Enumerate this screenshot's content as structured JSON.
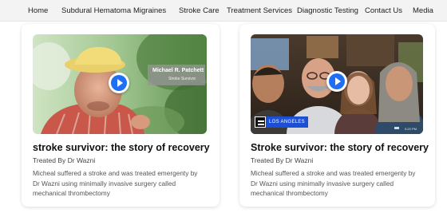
{
  "nav": {
    "items": [
      {
        "label": "Home"
      },
      {
        "label": "Subdural Hematoma"
      },
      {
        "label": "Migraines"
      },
      {
        "label": "Stroke Care"
      },
      {
        "label": "Treatment Services"
      },
      {
        "label": "Diagnostic Testing"
      },
      {
        "label": "Contact Us"
      },
      {
        "label": "Media"
      }
    ]
  },
  "cards": [
    {
      "title": "stroke survivor: the story of recovery",
      "subtitle": "Treated By Dr Wazni",
      "description": "Micheal suffered a stroke and was treated emergenty by Dr Wazni using minimally invasive surgery called mechanical thrombectomy",
      "video": {
        "overlay_name": "Michael R. Patchett",
        "overlay_role": "Stroke Survivor",
        "play_icon": "play-icon"
      }
    },
    {
      "title": "Stroke survivor: the story of recovery",
      "subtitle": "Treated By Dr Wazni",
      "description": "Micheal suffered a stroke and was treated emergenty by Dr Wazni using minimally invasive surgery called mechanical thrombectomy",
      "video": {
        "station_label": "LOS ANGELES",
        "timestamp": "5:20 PM",
        "play_icon": "play-icon"
      }
    }
  ],
  "colors": {
    "nav_bg": "#f3f3f3",
    "play_blue": "#1f6ff2",
    "station_blue": "#1a4fd6"
  }
}
